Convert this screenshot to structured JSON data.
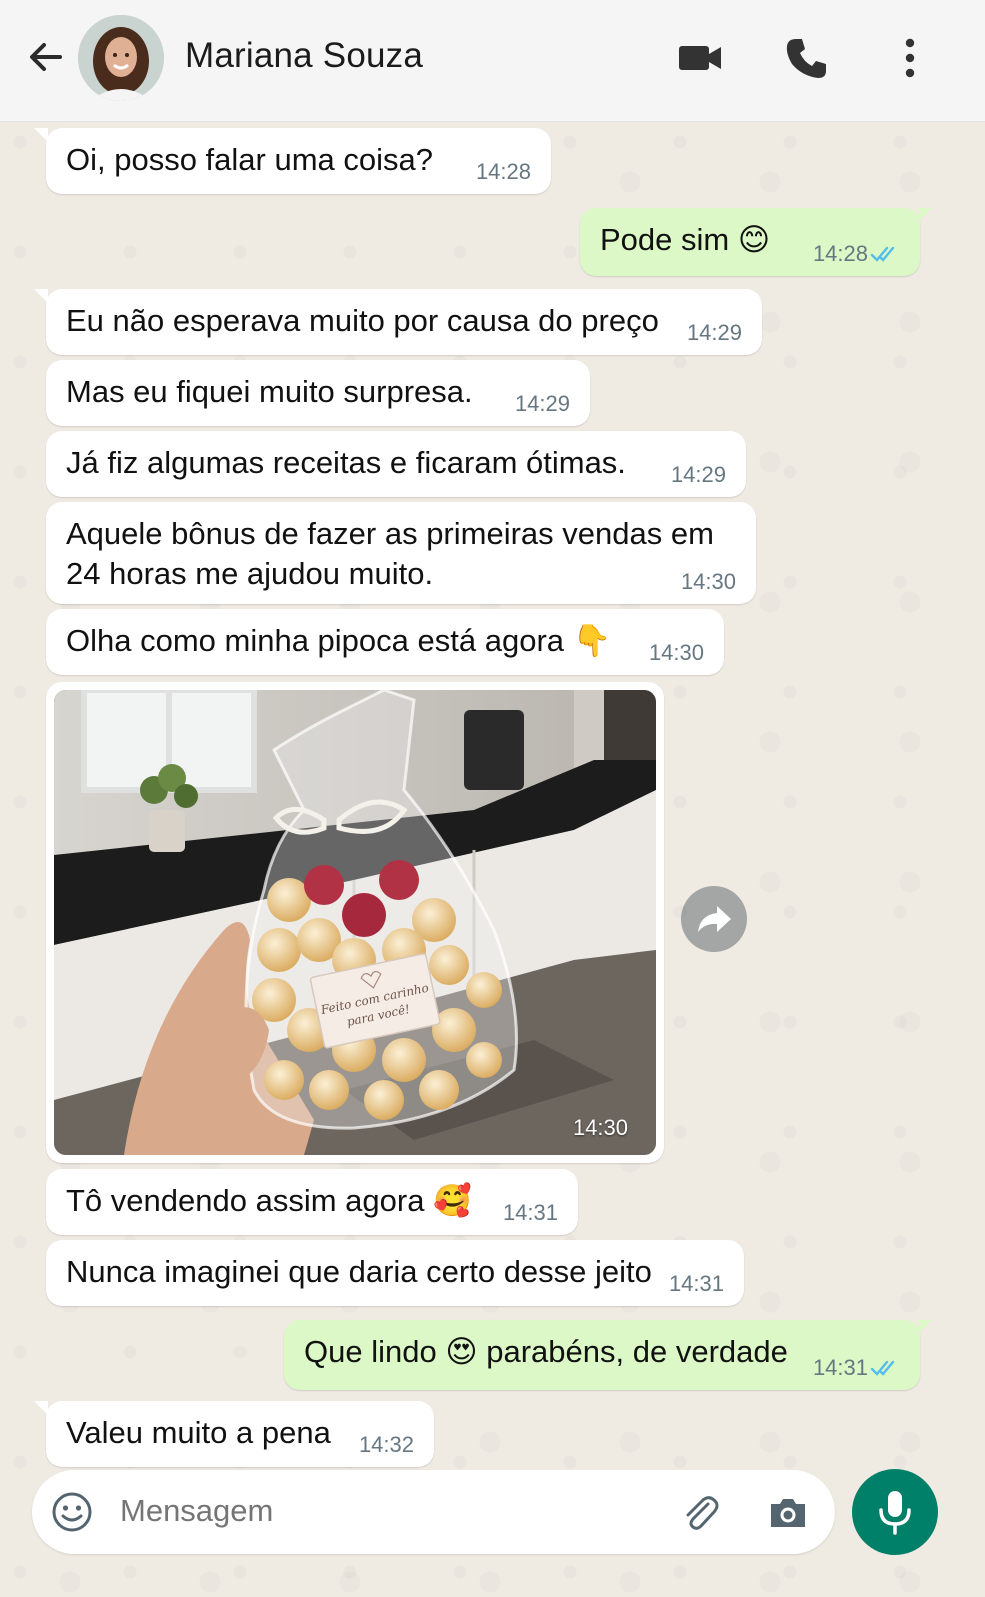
{
  "header": {
    "contact_name": "Mariana Souza",
    "icons": [
      "back-arrow-icon",
      "avatar",
      "video-camera-icon",
      "phone-icon",
      "more-vertical-icon"
    ]
  },
  "messages": [
    {
      "dir": "in",
      "text": "Oi, posso falar uma coisa?",
      "time": "14:28"
    },
    {
      "dir": "out",
      "text": "Pode sim 😊",
      "time": "14:28",
      "status": "read"
    },
    {
      "dir": "in",
      "text": "Eu não esperava muito por causa do preço",
      "time": "14:29"
    },
    {
      "dir": "in",
      "text": "Mas eu fiquei muito surpresa.",
      "time": "14:29"
    },
    {
      "dir": "in",
      "text": "Já fiz algumas receitas e ficaram ótimas.",
      "time": "14:29"
    },
    {
      "dir": "in",
      "text_line1": "Aquele bônus de fazer as primeiras vendas em",
      "text_line2": "24 horas me ajudou muito.",
      "time": "14:30"
    },
    {
      "dir": "in",
      "text": "Olha como minha pipoca está agora 👇",
      "time": "14:30"
    },
    {
      "dir": "in",
      "type": "image",
      "label_line1": "Feito com carinho",
      "label_line2": "para você!",
      "time": "14:30"
    },
    {
      "dir": "in",
      "text": "Tô vendendo assim agora 🥰",
      "time": "14:31"
    },
    {
      "dir": "in",
      "text": "Nunca imaginei que daria certo desse jeito",
      "time": "14:31"
    },
    {
      "dir": "out",
      "text": "Que lindo 😍 parabéns, de verdade",
      "time": "14:31",
      "status": "read"
    },
    {
      "dir": "in",
      "text": "Valeu muito a pena",
      "time": "14:32"
    }
  ],
  "input": {
    "placeholder": "Mensagem"
  },
  "colors": {
    "header_bg": "#f5f5f5",
    "chat_bg": "#efeae2",
    "incoming_bubble": "#ffffff",
    "outgoing_bubble": "#dcf8c6",
    "read_tick": "#53bdeb",
    "mic_button": "#008069"
  }
}
